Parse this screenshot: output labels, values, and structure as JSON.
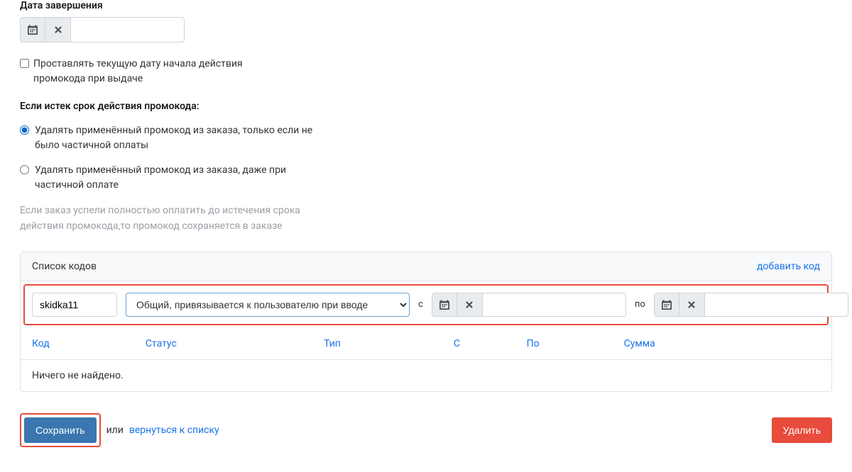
{
  "end_date": {
    "label": "Дата завершения",
    "value": ""
  },
  "set_current_date": {
    "label": "Проставлять текущую дату начала действия промокода при выдаче",
    "checked": false
  },
  "expiry_section": {
    "title": "Если истек срок действия промокода:",
    "option1": "Удалять применённый промокод из заказа, только если не было частичной оплаты",
    "option2": "Удалять применённый промокод из заказа, даже при частичной оплате",
    "help": "Если заказ успели полностью оплатить до истечения срока действия промокода,то промокод сохраняется в заказе"
  },
  "codes_panel": {
    "title": "Список кодов",
    "add_link": "добавить код",
    "code_value": "skidka11",
    "type_options": [
      "Общий, привязывается к пользователю при вводе"
    ],
    "type_selected": "Общий, привязывается к пользователю при вводе",
    "from_label": "с",
    "to_label": "по",
    "from_value": "",
    "to_value": ""
  },
  "table": {
    "headers": {
      "code": "Код",
      "status": "Статус",
      "type": "Тип",
      "from": "С",
      "to": "По",
      "sum": "Сумма"
    },
    "empty_message": "Ничего не найдено."
  },
  "actions": {
    "save": "Сохранить",
    "or": "или",
    "return": "вернуться к списку",
    "delete": "Удалить"
  }
}
